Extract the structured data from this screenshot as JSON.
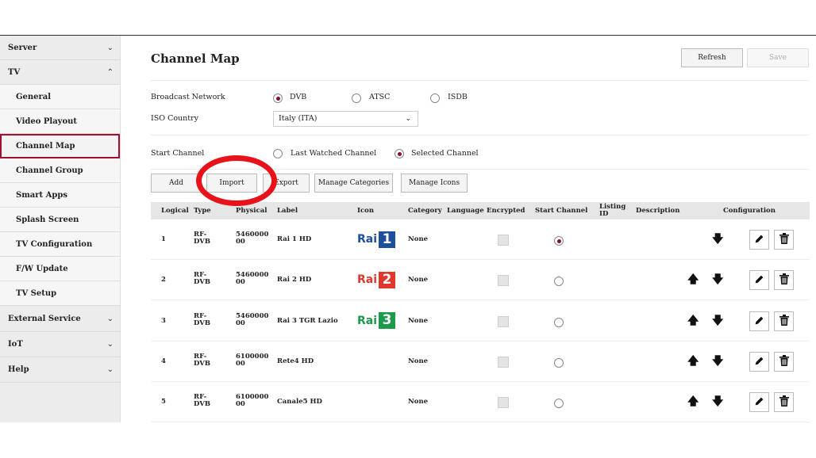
{
  "sidebar": {
    "items": [
      {
        "label": "Server",
        "chevron": "chevron-down"
      },
      {
        "label": "TV",
        "chevron": "chevron-up"
      },
      {
        "label": "General"
      },
      {
        "label": "Video Playout"
      },
      {
        "label": "Channel Map",
        "selected": true
      },
      {
        "label": "Channel Group"
      },
      {
        "label": "Smart Apps"
      },
      {
        "label": "Splash Screen"
      },
      {
        "label": "TV Configuration"
      },
      {
        "label": "F/W Update"
      },
      {
        "label": "TV Setup"
      },
      {
        "label": "External Service",
        "chevron": "chevron-down"
      },
      {
        "label": "IoT",
        "chevron": "chevron-down"
      },
      {
        "label": "Help",
        "chevron": "chevron-down"
      }
    ]
  },
  "header": {
    "title": "Channel Map",
    "refresh_label": "Refresh",
    "save_label": "Save"
  },
  "form": {
    "broadcast_network_label": "Broadcast Network",
    "network_options": [
      "DVB",
      "ATSC",
      "ISDB"
    ],
    "network_selected": "DVB",
    "iso_country_label": "ISO Country",
    "iso_country_value": "Italy (ITA)",
    "start_channel_label": "Start Channel",
    "start_channel_options": [
      "Last Watched Channel",
      "Selected Channel"
    ],
    "start_channel_selected": "Selected Channel"
  },
  "toolbar": {
    "add_label": "Add",
    "import_label": "Import",
    "export_label": "Export",
    "manage_categories_label": "Manage Categories",
    "manage_icons_label": "Manage Icons"
  },
  "table": {
    "headers": {
      "logical": "Logical",
      "type": "Type",
      "physical": "Physical",
      "label": "Label",
      "icon": "Icon",
      "category": "Category",
      "language": "Language",
      "encrypted": "Encrypted",
      "start_channel": "Start Channel",
      "listing_id_1": "Listing",
      "listing_id_2": "ID",
      "description": "Description",
      "configuration": "Configuration"
    },
    "rows": [
      {
        "logical": "1",
        "type1": "RF-",
        "type2": "DVB",
        "phys1": "5460000",
        "phys2": "00",
        "label": "Rai 1 HD",
        "icon_word": "Rai",
        "icon_num": "1",
        "icon_color": "#1d4f9c",
        "category": "None",
        "start": true
      },
      {
        "logical": "2",
        "type1": "RF-",
        "type2": "DVB",
        "phys1": "5460000",
        "phys2": "00",
        "label": "Rai 2 HD",
        "icon_word": "Rai",
        "icon_num": "2",
        "icon_color": "#e0362c",
        "category": "None",
        "start": false
      },
      {
        "logical": "3",
        "type1": "RF-",
        "type2": "DVB",
        "phys1": "5460000",
        "phys2": "00",
        "label": "Rai 3 TGR Lazio",
        "icon_word": "Rai",
        "icon_num": "3",
        "icon_color": "#1a9a4a",
        "category": "None",
        "start": false
      },
      {
        "logical": "4",
        "type1": "RF-",
        "type2": "DVB",
        "phys1": "6100000",
        "phys2": "00",
        "label": "Rete4 HD",
        "icon_word": "",
        "icon_num": "",
        "icon_color": "",
        "category": "None",
        "start": false
      },
      {
        "logical": "5",
        "type1": "RF-",
        "type2": "DVB",
        "phys1": "6100000",
        "phys2": "00",
        "label": "Canale5 HD",
        "icon_word": "",
        "icon_num": "",
        "icon_color": "",
        "category": "None",
        "start": false
      }
    ]
  },
  "colors": {
    "accent": "#8a0b2e",
    "annotation": "#e8131a"
  }
}
